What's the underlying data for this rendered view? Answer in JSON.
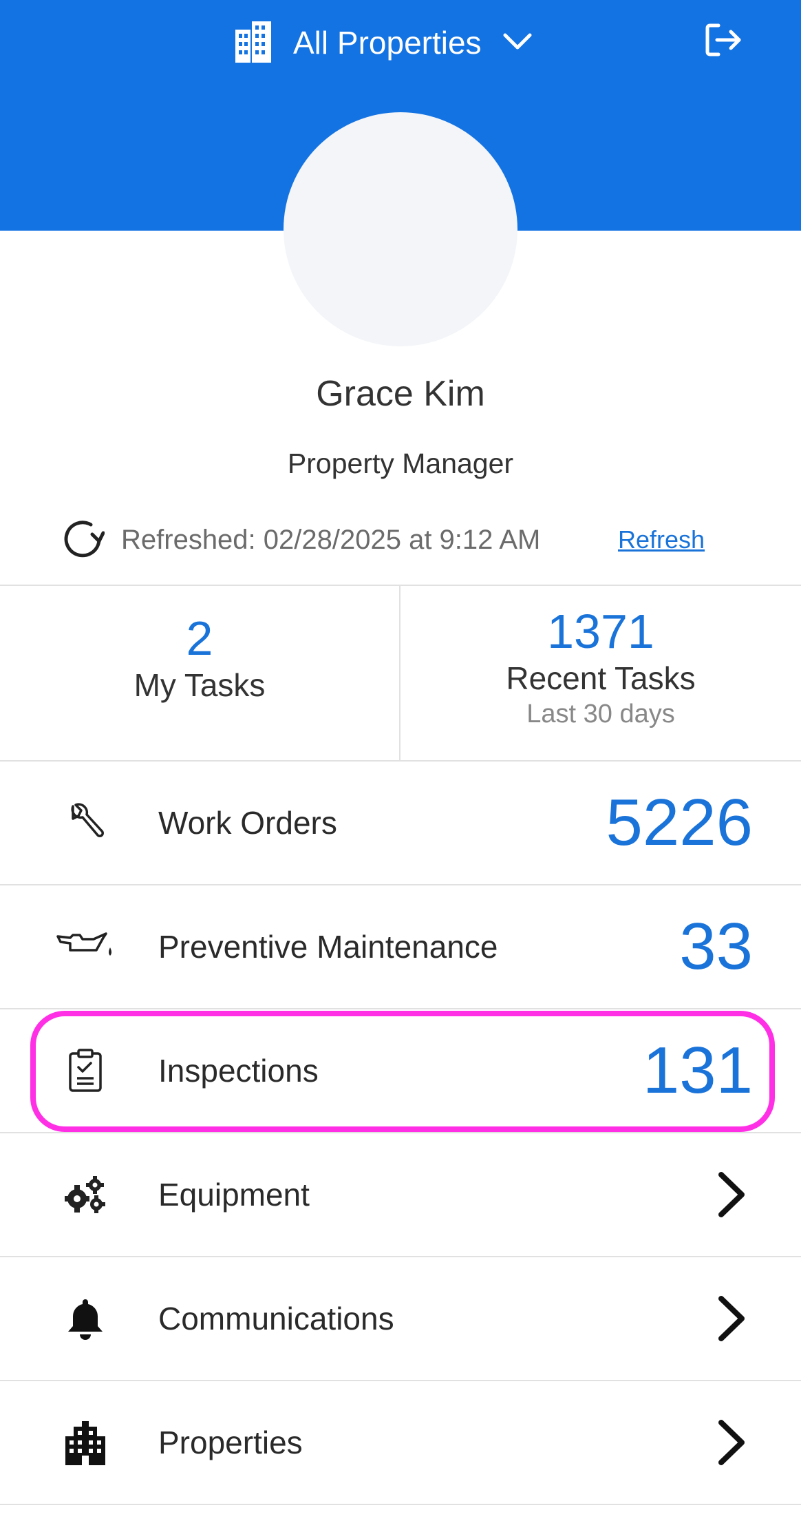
{
  "header": {
    "property_selector": "All Properties",
    "bg_color": "#1473e2"
  },
  "profile": {
    "name": "Grace Kim",
    "role": "Property Manager"
  },
  "refresh": {
    "text": "Refreshed: 02/28/2025 at 9:12 AM",
    "link": "Refresh"
  },
  "tasks": {
    "my_tasks": {
      "count": "2",
      "label": "My Tasks"
    },
    "recent_tasks": {
      "count": "1371",
      "label": "Recent Tasks",
      "sub": "Last 30 days"
    }
  },
  "menu": [
    {
      "label": "Work Orders",
      "value": "5226",
      "icon": "wrench-icon"
    },
    {
      "label": "Preventive Maintenance",
      "value": "33",
      "icon": "oil-can-icon"
    },
    {
      "label": "Inspections",
      "value": "131",
      "icon": "clipboard-check-icon"
    },
    {
      "label": "Equipment",
      "icon": "gears-icon"
    },
    {
      "label": "Communications",
      "icon": "bell-icon"
    },
    {
      "label": "Properties",
      "icon": "building-icon"
    }
  ],
  "colors": {
    "accent": "#1a73d9",
    "highlight": "#ff2fe6"
  }
}
